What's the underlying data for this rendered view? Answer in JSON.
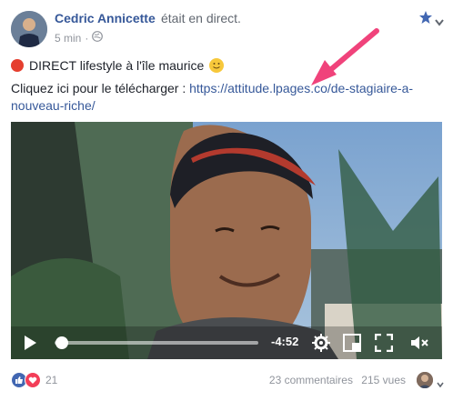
{
  "post": {
    "author": "Cedric Annicette",
    "action": "était en direct.",
    "time": "5 min",
    "separator": "·",
    "title": "DIRECT lifestyle à l'île maurice",
    "cta_prefix": "Cliquez ici pour le télécharger :",
    "link": "https://attitude.lpages.co/de-stagiaire-a-nouveau-riche/"
  },
  "video": {
    "remaining": "-4:52",
    "progress": 0.0
  },
  "footer": {
    "reactions_count": "21",
    "comments": "23 commentaires",
    "views": "215 vues"
  },
  "icons": {
    "accent": "#365899",
    "star_color": "#4267b2",
    "live_dot": "#e53f2f",
    "arrow_color": "#f0437b"
  }
}
